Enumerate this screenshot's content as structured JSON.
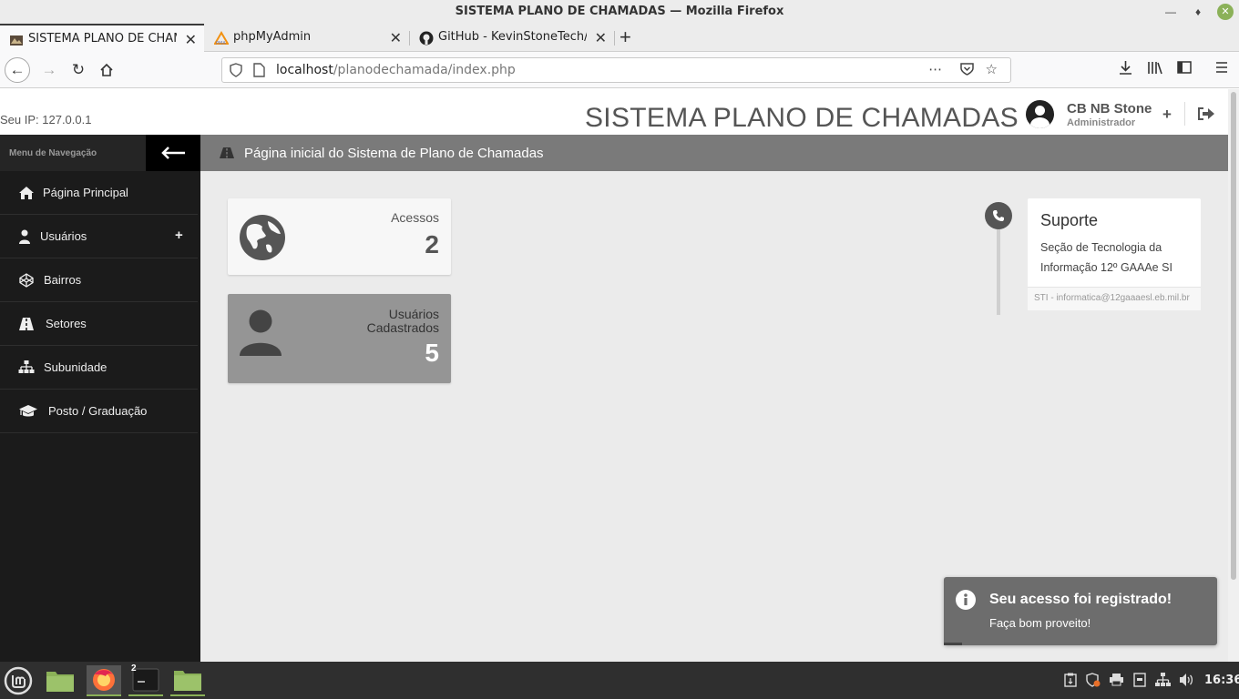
{
  "window": {
    "title": "SISTEMA PLANO DE CHAMADAS — Mozilla Firefox"
  },
  "tabs": [
    {
      "label": "SISTEMA PLANO DE CHAMADAS"
    },
    {
      "label": "phpMyAdmin"
    },
    {
      "label": "GitHub - KevinStoneTech/KevinStoneTech"
    }
  ],
  "urlbar": {
    "host": "localhost",
    "path": "/planodechamada/index.php"
  },
  "header": {
    "ip_label": "Seu IP: 127.0.0.1",
    "system_title": "SISTEMA PLANO DE CHAMADAS",
    "user_name": "CB NB Stone",
    "user_role": "Administrador",
    "plus": "+"
  },
  "sidebar": {
    "title": "Menu de Navegação",
    "items": [
      {
        "label": "Página Principal",
        "icon": "home-icon"
      },
      {
        "label": "Usuários",
        "icon": "user-icon",
        "expand": "+"
      },
      {
        "label": "Bairros",
        "icon": "codepen-icon"
      },
      {
        "label": "Setores",
        "icon": "road-icon"
      },
      {
        "label": "Subunidade",
        "icon": "sitemap-icon"
      },
      {
        "label": "Posto / Graduação",
        "icon": "graduation-cap-icon"
      }
    ]
  },
  "breadcrumb": {
    "text": "Página inicial do Sistema de Plano de Chamadas"
  },
  "cards": [
    {
      "label": "Acessos",
      "value": "2",
      "icon": "globe-icon"
    },
    {
      "label_line1": "Usuários",
      "label_line2": "Cadastrados",
      "value": "5",
      "icon": "user-icon"
    }
  ],
  "support": {
    "title": "Suporte",
    "body": "Seção de Tecnologia da Informação 12º GAAAe SI",
    "footer": "STI - informatica@12gaaaesl.eb.mil.br"
  },
  "toast": {
    "title": "Seu acesso foi registrado!",
    "message": "Faça bom proveito!"
  },
  "taskbar": {
    "clock": "16:36",
    "terminal_badge": "2"
  },
  "colors": {
    "sidebar": "#1b1b1b",
    "breadcrumb": "#7a7a7a",
    "content_bg": "#ebebeb",
    "toast": "#6d6d6d",
    "accent": "#8bb158"
  }
}
